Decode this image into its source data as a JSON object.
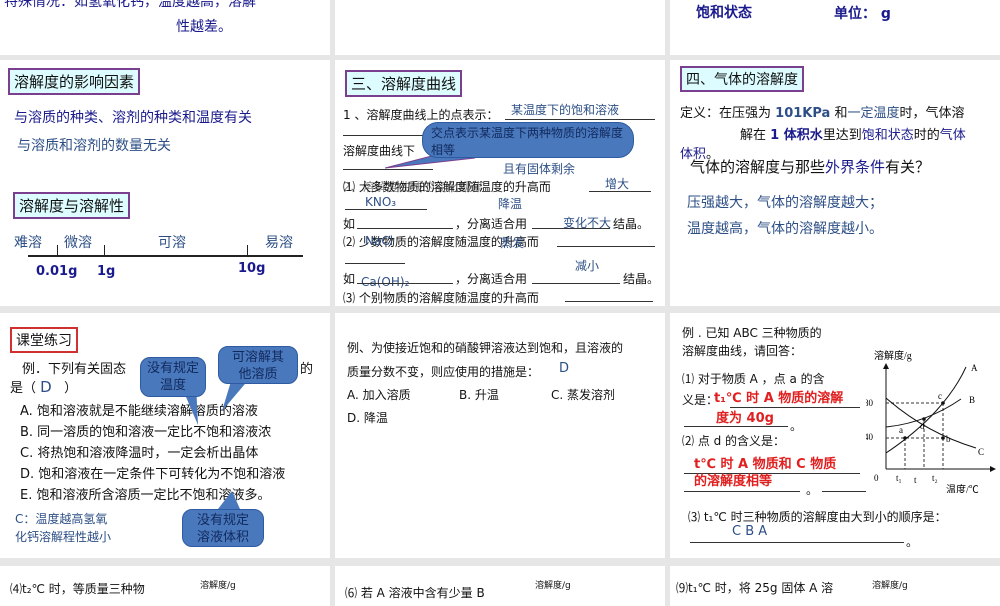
{
  "slide_top_left": {
    "cut_line": "特殊情况：如氢氧化钙，温度越高，溶解",
    "line2": "性越差。"
  },
  "slide_top_right": {
    "left": "饱和状态",
    "right": "单位： g"
  },
  "slide_factors": {
    "header1": "溶解度的影响因素",
    "line1": "与溶质的种类、溶剂的种类和温度有关",
    "line2": "与溶质和溶剂的数量无关",
    "header2": "溶解度与溶解性",
    "categories": [
      "难溶",
      "微溶",
      "可溶",
      "易溶"
    ],
    "ticks": [
      "0.01g",
      "1g",
      "10g"
    ]
  },
  "slide_curve": {
    "header": "三、溶解度曲线",
    "l1": "1 、溶解度曲线上的点表示：",
    "a1": "某温度下的饱和溶液",
    "callout": "交点表示某温度下两种物质的溶解度相等",
    "l2": "溶解度曲线下",
    "a2": "且有固体剩余",
    "l3": "2、溶解度曲线的变化规律",
    "l3b": "⑴ 大多数物质的溶解度随温度的升高而",
    "a3": "增大",
    "a4": "KNO₃",
    "a5": "降温",
    "l4a": "如",
    "l4b": "，分离适合用",
    "l4c": "结晶。",
    "a6": "变化不大",
    "l5": "⑵ 少数物质的溶解度随温度的升高而",
    "a7": "NaCl",
    "a8": "蒸发",
    "a9": "减小",
    "a10": "Ca(OH)₂",
    "l6": "⑶ 个别物质的溶解度随温度的升高而"
  },
  "slide_gas": {
    "header": "四、气体的溶解度",
    "def1": "定义：在压强为",
    "def_kpa": "101KPa",
    "def_and": "和",
    "def_temp": "一定温度",
    "def_tail": "时，气体溶",
    "def2a": "解在",
    "def2b": "1 体积水",
    "def2c": "里达到",
    "def2d": "饱和状态",
    "def2e": "时的",
    "def2f": "气体",
    "def3": "体积",
    "def3b": "。",
    "q1": "气体的溶解度与那些",
    "q2": "外界条件",
    "q3": "有关？",
    "ans1": "压强越大，气体的溶解度越大；",
    "ans2": "温度越高，气体的溶解度越小。"
  },
  "slide_practice": {
    "header": "课堂练习",
    "q": "例．下列有关固态",
    "q_tail": "的",
    "q2": "是（",
    "answer": "D",
    "q2_end": "）",
    "options": [
      "A. 饱和溶液就是不能继续溶解溶质的溶液",
      "B. 同一溶质的饱和溶液一定比不饱和溶液浓",
      "C. 将热饱和溶液降温时，一定会析出晶体",
      "D. 饱和溶液在一定条件下可转化为不饱和溶液",
      "E. 饱和溶液所含溶质一定比不饱和溶液多。"
    ],
    "note1": "C：温度越高氢氧",
    "note2": "化钙溶解程性越小",
    "callout1": "没有规定温度",
    "callout2": "可溶解其他溶质",
    "callout3": "没有规定溶液体积"
  },
  "slide_kno3": {
    "q1": "例、为使接近饱和的硝酸钾溶液达到饱和，且溶液的",
    "q2": "质量分数不变，则应使用的措施是：",
    "answer": "D",
    "options": [
      "A. 加入溶质",
      "B. 升温",
      "C. 蒸发溶剂",
      "D. 降温"
    ]
  },
  "slide_abc": {
    "intro1": "例 . 已知 ABC 三种物质的",
    "intro2": "溶解度曲线，请回答：",
    "q1": "⑴ 对于物质 A ，点 a 的含",
    "q1b": "义是：",
    "a1a": "t₁℃ 时 A 物质的溶解",
    "a1b": "度为 40g",
    "q2": "⑵ 点 d 的含义是：",
    "a2a": "t℃ 时 A 物质和 C 物质",
    "a2b": "的溶解度相等",
    "q3": "⑶ t₁℃ 时三种物质的溶解度由大到小的顺序是：",
    "a3": "C  B  A",
    "period": "。",
    "chart_data": {
      "type": "line",
      "ylabel": "溶解度/g",
      "xlabel": "温度/℃",
      "yticks": [
        "40",
        "80"
      ],
      "xticks": [
        "0",
        "t₁",
        "t",
        "t₂"
      ],
      "series": [
        {
          "name": "A"
        },
        {
          "name": "B"
        },
        {
          "name": "C"
        }
      ],
      "points": [
        "a",
        "b",
        "c",
        "d"
      ]
    }
  },
  "bottom": [
    {
      "text": "⑷t₂℃ 时，等质量三种物",
      "ylabel": "溶解度/g"
    },
    {
      "text": "⑹ 若 A 溶液中含有少量 B",
      "ylabel": "溶解度/g"
    },
    {
      "text": "⑼t₁℃ 时，将 25g 固体 A 溶",
      "ylabel": "溶解度/g"
    }
  ],
  "colors": {
    "header_bg": "#ddfcff",
    "header_border": "#7a3f8e",
    "callout": "#4a78bd",
    "answer_red": "#e02020",
    "navy": "#1a1a8c"
  }
}
